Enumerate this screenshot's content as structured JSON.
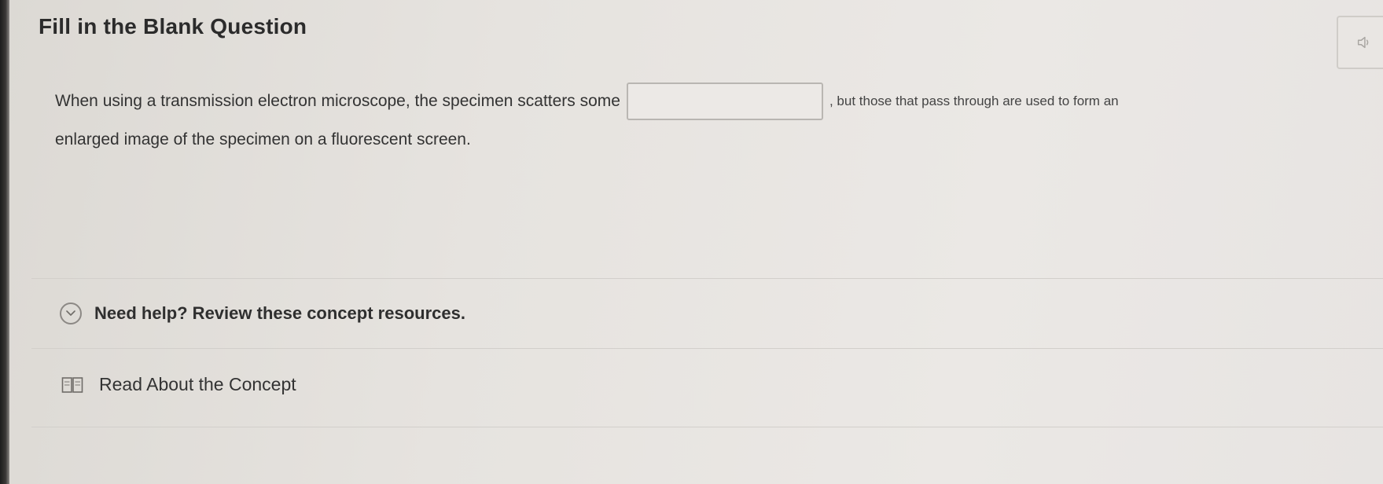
{
  "question": {
    "title": "Fill in the Blank Question",
    "text_before": "When using a transmission electron microscope, the specimen scatters some",
    "blank_value": "",
    "text_after": ", but those that pass through are used to form an",
    "text_line2": "enlarged image of the specimen on a fluorescent screen."
  },
  "toolbar": {
    "audio_icon": "speaker-icon"
  },
  "help": {
    "toggle_label": "Need help? Review these concept resources.",
    "toggle_icon": "chevron-down-icon"
  },
  "resources": [
    {
      "label": "Read About the Concept",
      "icon": "book-icon"
    }
  ]
}
